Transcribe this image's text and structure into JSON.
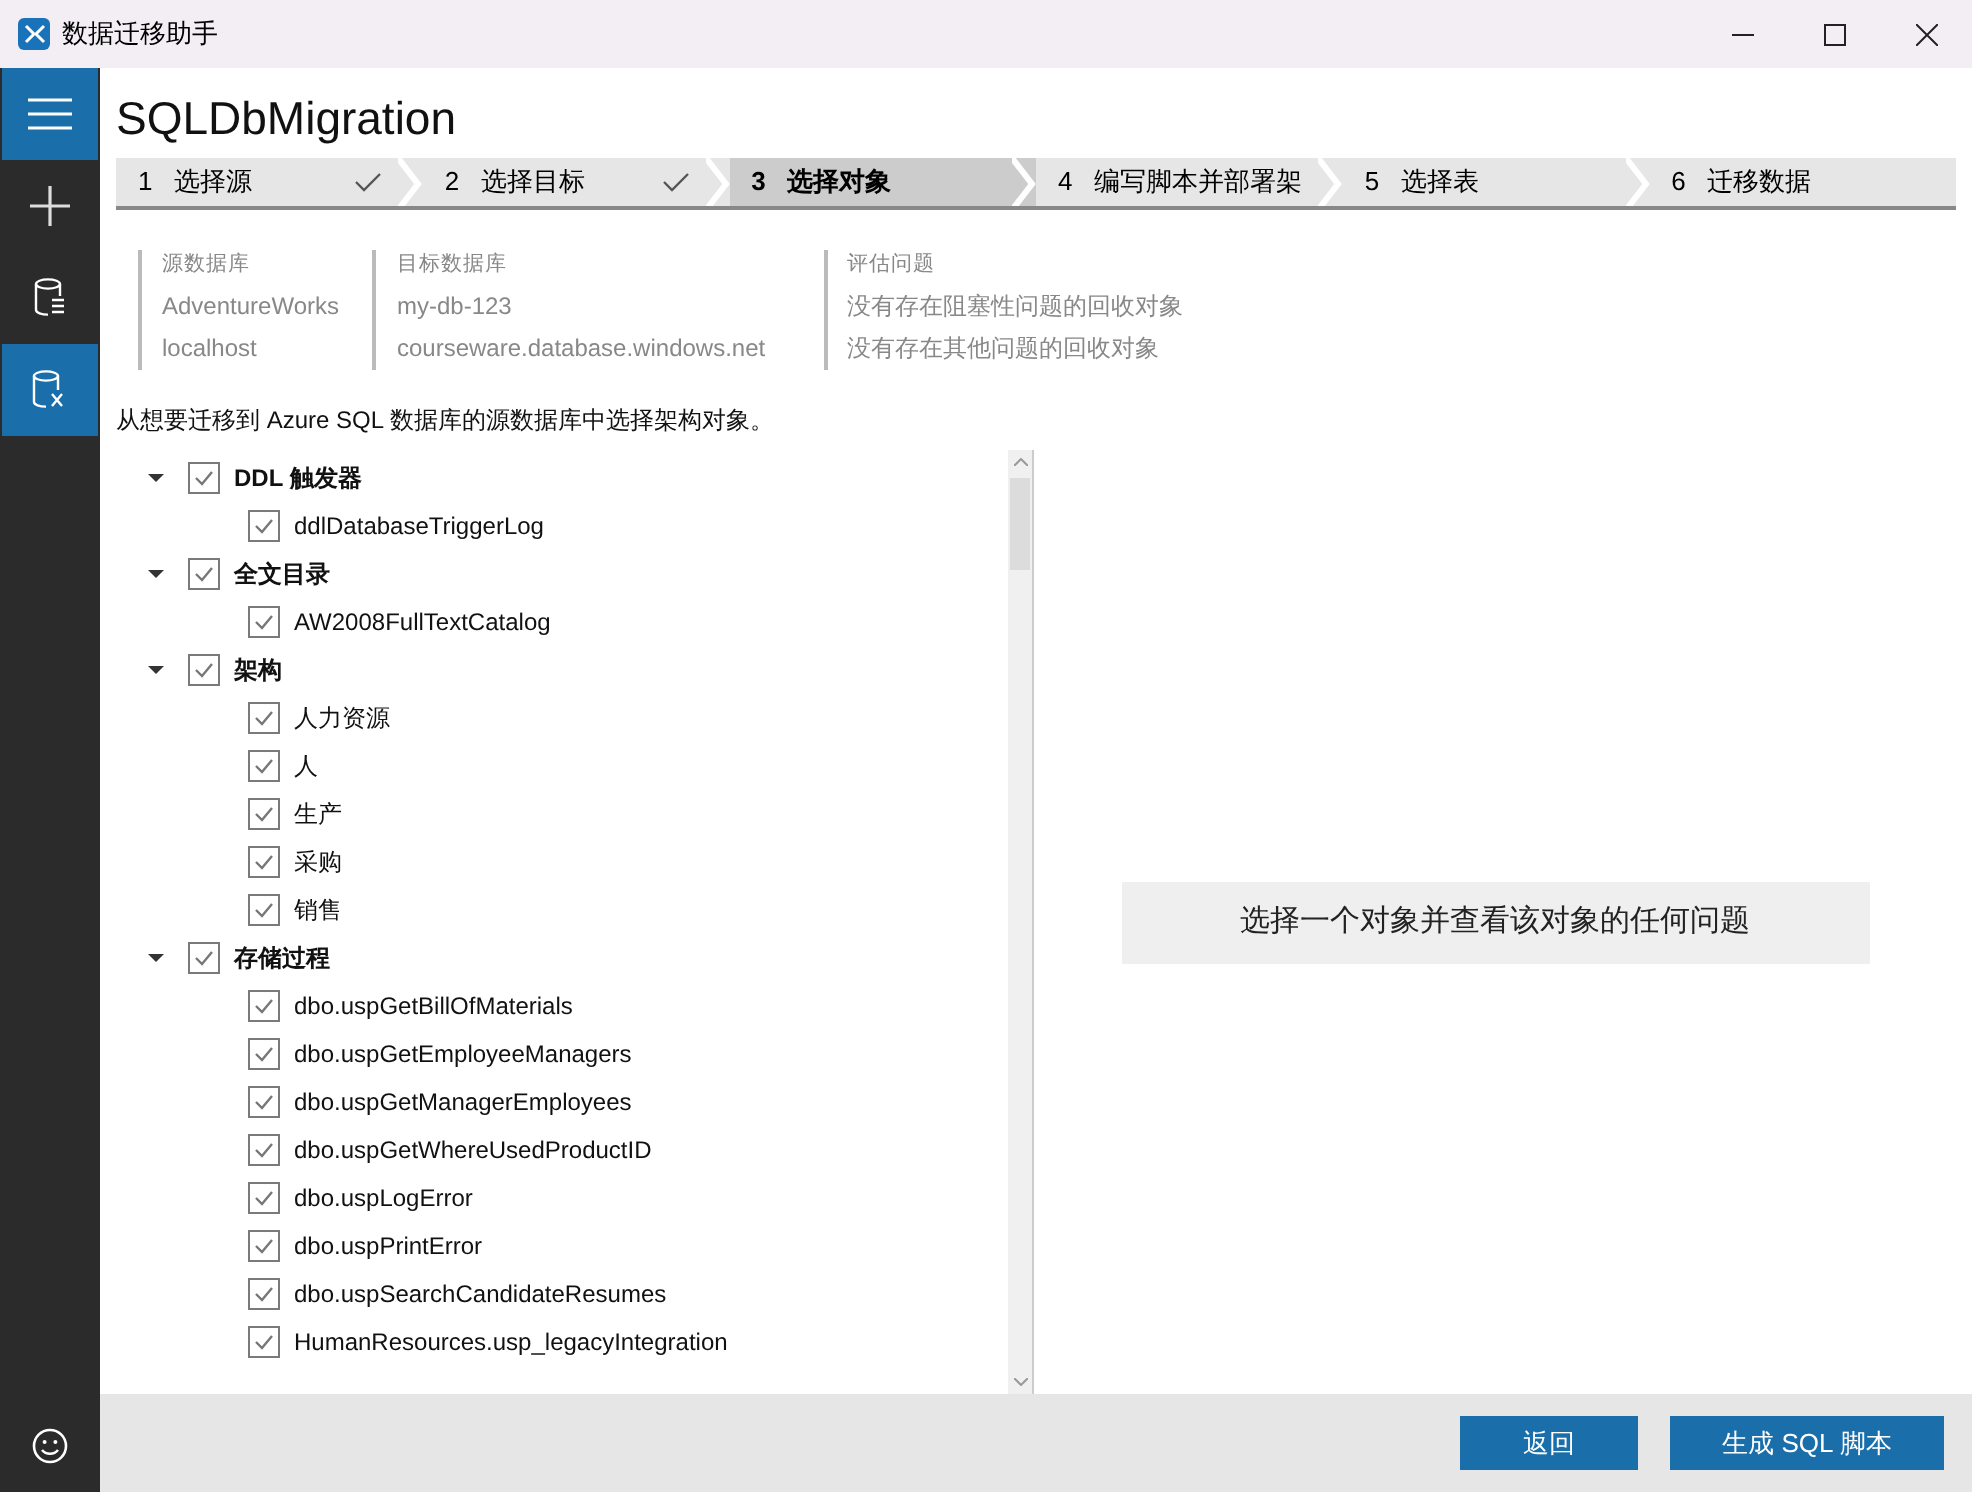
{
  "window": {
    "title": "数据迁移助手"
  },
  "sidebar": {
    "items": [
      {
        "kind": "menu",
        "selected": true
      },
      {
        "kind": "new",
        "selected": false
      },
      {
        "kind": "assess",
        "selected": false
      },
      {
        "kind": "migrate",
        "selected": true
      },
      {
        "kind": "feedback",
        "selected": false
      }
    ]
  },
  "page_title": "SQLDbMigration",
  "steps": [
    {
      "number": "1",
      "label": "选择源",
      "done": true,
      "selected": false
    },
    {
      "number": "2",
      "label": "选择目标",
      "done": true,
      "selected": false
    },
    {
      "number": "3",
      "label": "选择对象",
      "done": false,
      "selected": true
    },
    {
      "number": "4",
      "label": "编写脚本并部署架",
      "done": false,
      "selected": false
    },
    {
      "number": "5",
      "label": "选择表",
      "done": false,
      "selected": false
    },
    {
      "number": "6",
      "label": "迁移数据",
      "done": false,
      "selected": false
    }
  ],
  "info": [
    {
      "heading": "源数据库",
      "lines": [
        "AdventureWorks",
        "localhost"
      ]
    },
    {
      "heading": "目标数据库",
      "lines": [
        "my-db-123",
        "courseware.database.windows.net"
      ]
    },
    {
      "heading": "评估问题",
      "lines": [
        "没有存在阻塞性问题的回收对象",
        "没有存在其他问题的回收对象"
      ]
    }
  ],
  "instruction": "从想要迁移到 Azure SQL 数据库的源数据库中选择架构对象。",
  "tree": [
    {
      "label": "DDL 触发器",
      "expanded": true,
      "checked": true,
      "children": [
        {
          "label": "ddlDatabaseTriggerLog",
          "checked": true
        }
      ]
    },
    {
      "label": "全文目录",
      "expanded": true,
      "checked": true,
      "children": [
        {
          "label": "AW2008FullTextCatalog",
          "checked": true
        }
      ]
    },
    {
      "label": "架构",
      "expanded": true,
      "checked": true,
      "children": [
        {
          "label": "人力资源",
          "checked": true
        },
        {
          "label": "人",
          "checked": true
        },
        {
          "label": "生产",
          "checked": true
        },
        {
          "label": "采购",
          "checked": true
        },
        {
          "label": "销售",
          "checked": true
        }
      ]
    },
    {
      "label": "存储过程",
      "expanded": true,
      "checked": true,
      "children": [
        {
          "label": "dbo.uspGetBillOfMaterials",
          "checked": true
        },
        {
          "label": "dbo.uspGetEmployeeManagers",
          "checked": true
        },
        {
          "label": "dbo.uspGetManagerEmployees",
          "checked": true
        },
        {
          "label": "dbo.uspGetWhereUsedProductID",
          "checked": true
        },
        {
          "label": "dbo.uspLogError",
          "checked": true
        },
        {
          "label": "dbo.uspPrintError",
          "checked": true
        },
        {
          "label": "dbo.uspSearchCandidateResumes",
          "checked": true
        },
        {
          "label": "HumanResources.usp_legacyIntegration",
          "checked": true
        }
      ]
    }
  ],
  "details_message": "选择一个对象并查看该对象的任何问题",
  "buttons": [
    "返回",
    "生成 SQL 脚本"
  ]
}
